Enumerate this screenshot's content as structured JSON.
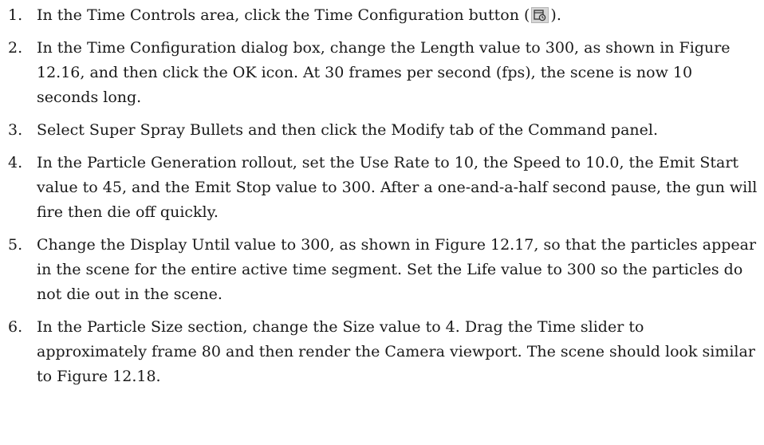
{
  "steps": [
    {
      "number": "1.",
      "text_before_icon": "In the Time Controls area, click the Time Configuration button (",
      "icon": "time-configuration-icon",
      "text_after_icon": ")."
    },
    {
      "number": "2.",
      "text": "In the Time Configuration dialog box, change the Length value to 300, as shown in Figure 12.16, and then click the OK icon. At 30 frames per second (fps), the scene is now 10 seconds long."
    },
    {
      "number": "3.",
      "text": "Select Super Spray Bullets and then click the Modify tab of the Command panel."
    },
    {
      "number": "4.",
      "text": "In the Particle Generation rollout, set the Use Rate to 10, the Speed to 10.0, the Emit Start value to 45, and the Emit Stop value to 300. After a one-and-a-half second pause, the gun will fire then die off quickly."
    },
    {
      "number": "5.",
      "text": "Change the Display Until value to 300, as shown in Figure 12.17, so that the particles appear in the scene for the entire active time segment. Set the Life value to 300 so the particles do not die out in the scene."
    },
    {
      "number": "6.",
      "text": "In the Particle Size section, change the Size value to 4. Drag the Time slider to approximately frame 80 and then render the Camera viewport. The scene should look similar to Figure 12.18."
    }
  ]
}
